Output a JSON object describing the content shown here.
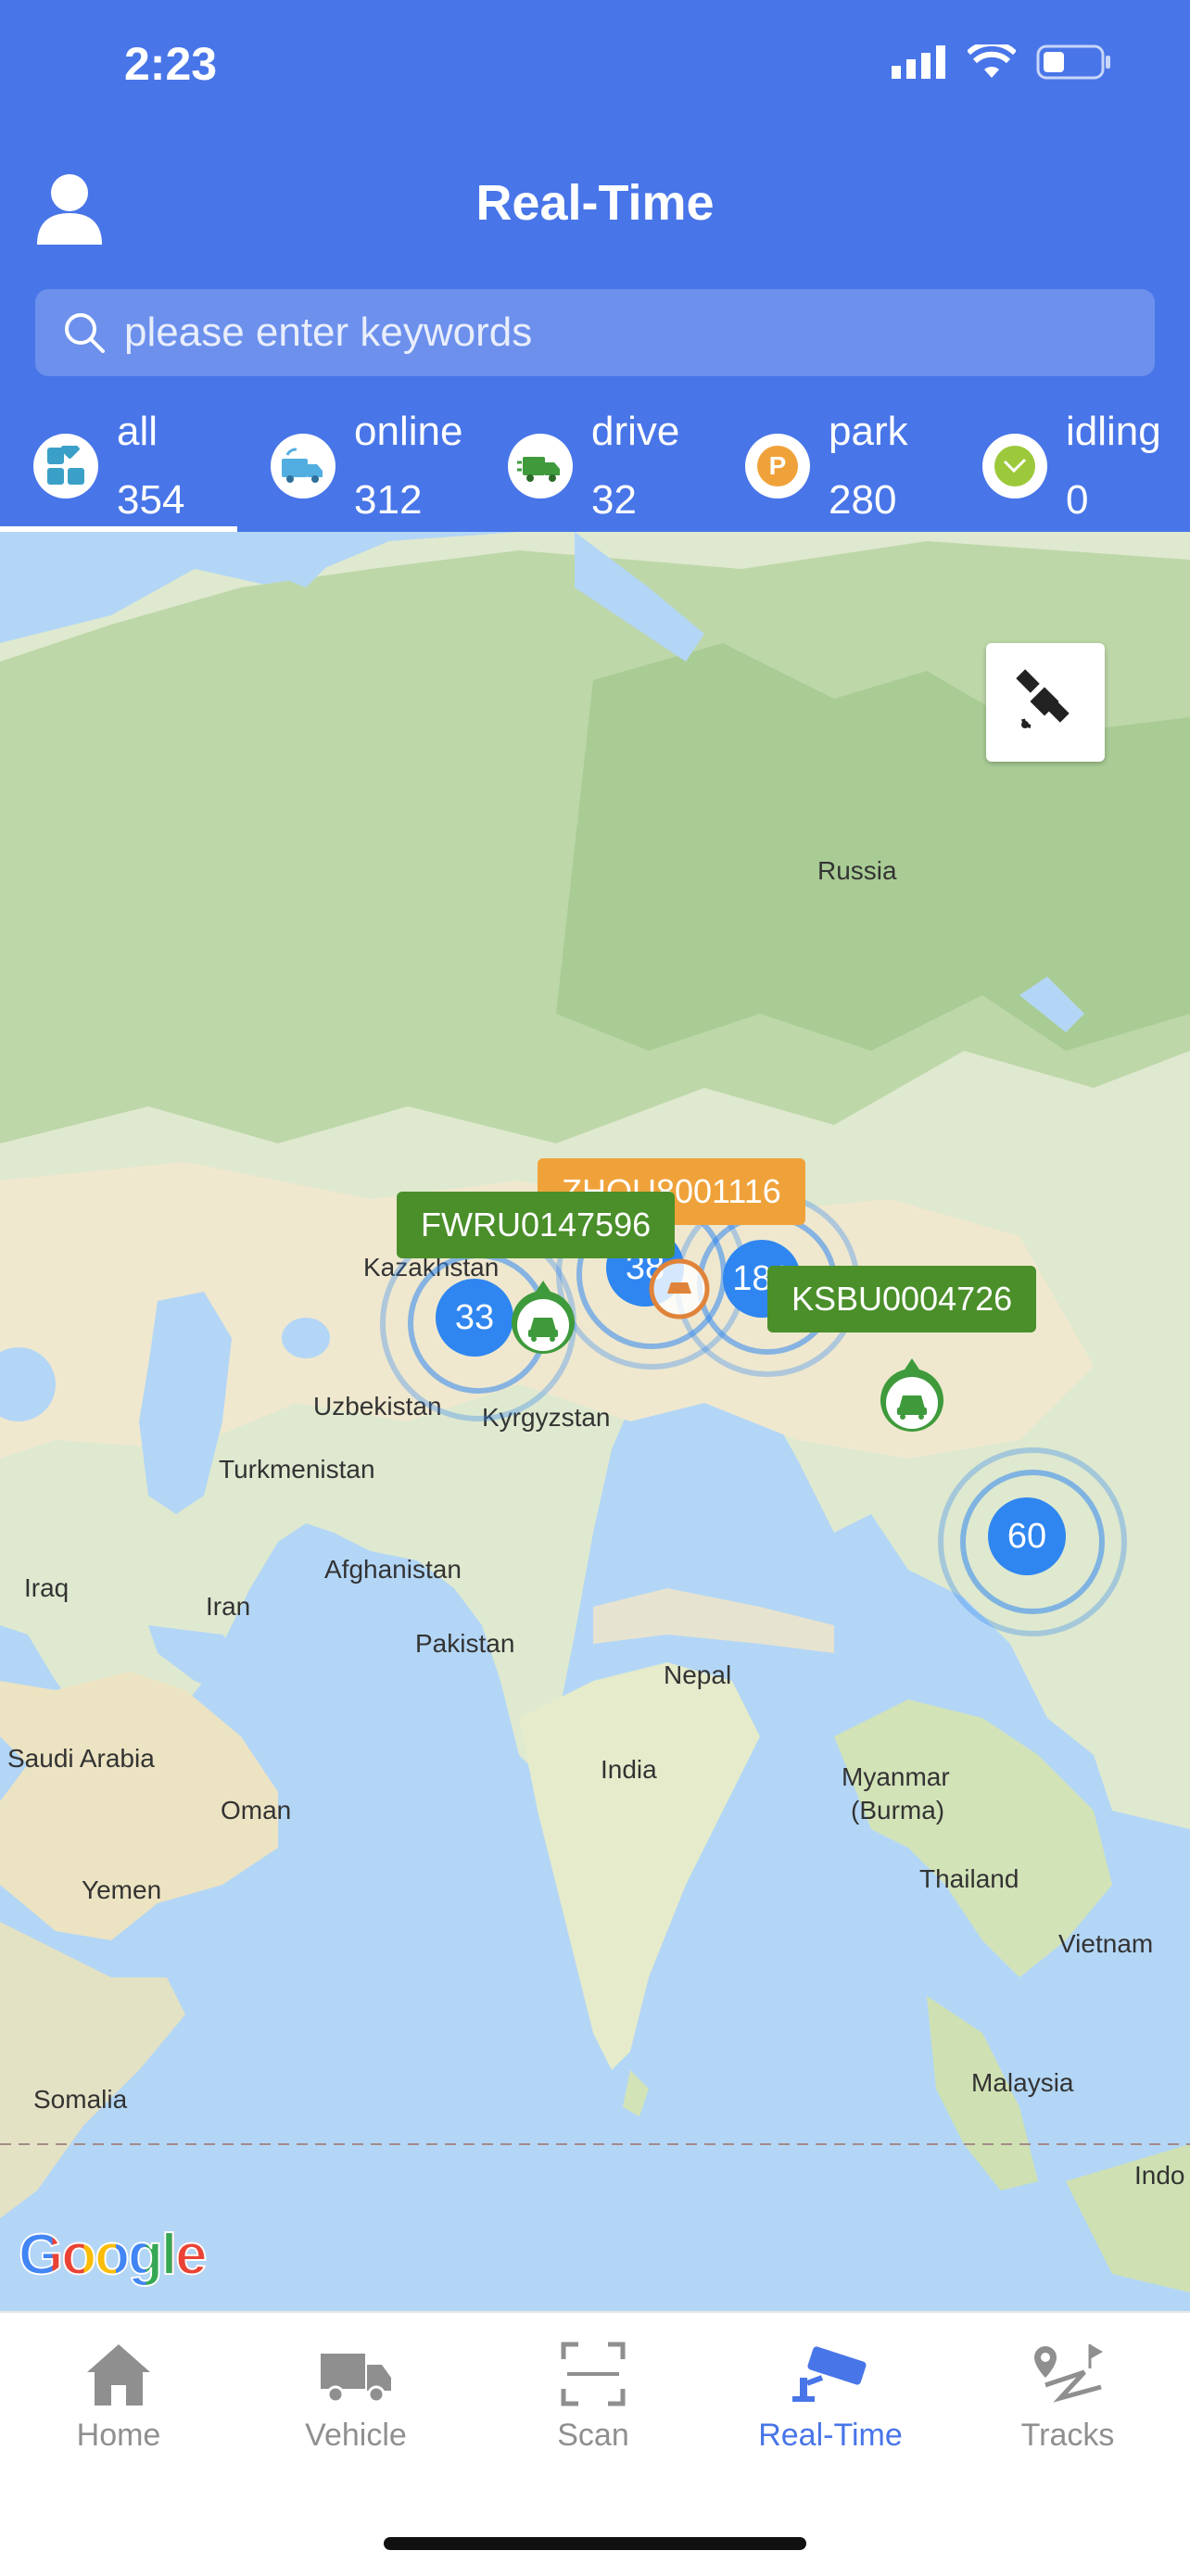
{
  "status": {
    "time": "2:23"
  },
  "header": {
    "title": "Real-Time"
  },
  "search": {
    "placeholder": "please enter keywords"
  },
  "filters": [
    {
      "label": "all",
      "count": "354"
    },
    {
      "label": "online",
      "count": "312"
    },
    {
      "label": "drive",
      "count": "32"
    },
    {
      "label": "park",
      "count": "280"
    },
    {
      "label": "idling",
      "count": "0"
    }
  ],
  "map": {
    "labels": [
      "Russia",
      "Kazakhstan",
      "Uzbekistan",
      "Kyrgyzstan",
      "Turkmenistan",
      "Afghanistan",
      "Iraq",
      "Iran",
      "Pakistan",
      "Nepal",
      "Saudi Arabia",
      "Oman",
      "Yemen",
      "India",
      "Myanmar",
      "(Burma)",
      "Thailand",
      "Vietnam",
      "Malaysia",
      "Somalia",
      "Indo"
    ],
    "vehicle_tags": [
      "ZHQU8001116",
      "FWRU0147596",
      "KSBU0004726"
    ],
    "clusters": [
      "33",
      "38",
      "181",
      "60"
    ],
    "attribution": "Google"
  },
  "tabbar": [
    "Home",
    "Vehicle",
    "Scan",
    "Real-Time",
    "Tracks"
  ],
  "colors": {
    "primary": "#4875e8",
    "tag_green": "#4a8f2a",
    "tag_orange": "#f0a23a"
  }
}
